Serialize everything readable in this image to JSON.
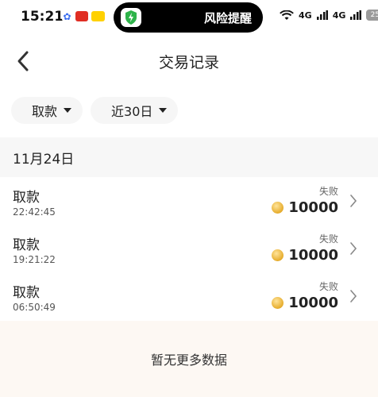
{
  "status_bar": {
    "time": "15:21",
    "island_text": "风险提醒",
    "signal_1": "4G",
    "signal_2": "4G",
    "battery": "25"
  },
  "nav": {
    "title": "交易记录"
  },
  "filters": {
    "type": "取款",
    "range": "近30日"
  },
  "date_header": "11月24日",
  "transactions": [
    {
      "title": "取款",
      "time": "22:42:45",
      "status": "失败",
      "amount": "10000"
    },
    {
      "title": "取款",
      "time": "19:21:22",
      "status": "失败",
      "amount": "10000"
    },
    {
      "title": "取款",
      "time": "06:50:49",
      "status": "失败",
      "amount": "10000"
    }
  ],
  "footer": {
    "no_more": "暂无更多数据"
  },
  "colors": {
    "coin": "#e6ac2c",
    "footer_bg": "#fdf8f3",
    "date_header_bg": "#f7f7f7"
  }
}
